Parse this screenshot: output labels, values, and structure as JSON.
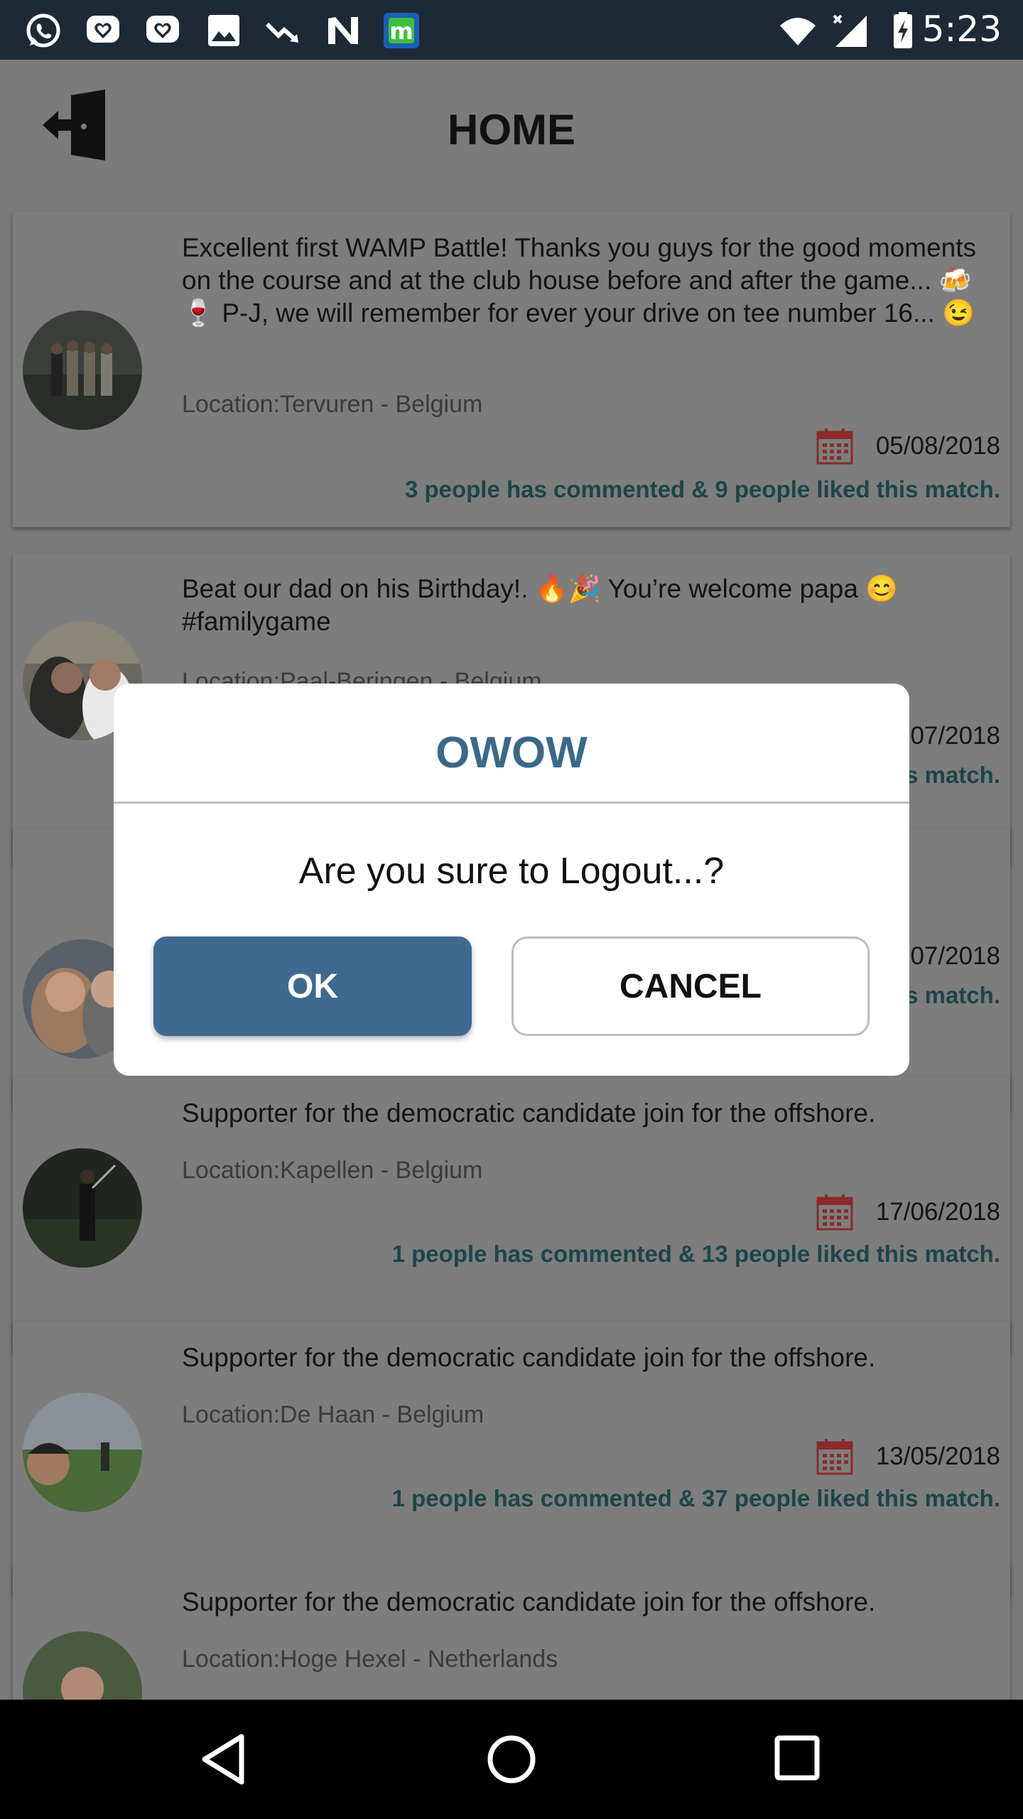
{
  "status_bar": {
    "time": "5:23",
    "left_icons": [
      "whatsapp-icon",
      "heart-chat-icon",
      "heart-chat-icon",
      "image-icon",
      "trend-down-icon",
      "n-icon",
      "m-app-icon"
    ],
    "right_icons": [
      "wifi-icon",
      "cell-signal-icon",
      "battery-charging-icon"
    ]
  },
  "header": {
    "title": "HOME",
    "logout_icon": "logout-door-icon"
  },
  "posts": [
    {
      "text": "Excellent first WAMP Battle! Thanks you guys for the good moments on the course and at the club house before and after the game... 🍻🍷 P-J, we will remember for ever your drive on tee number 16... 😉",
      "location": "Location:Tervuren - Belgium",
      "date": "05/08/2018",
      "stats": "3 people has commented & 9 people liked this match."
    },
    {
      "text": "Beat our dad on his Birthday!. 🔥🎉 You’re welcome papa 😊 #familygame",
      "location": "Location:Paal-Beringen - Belgium",
      "date": "07/2018",
      "stats": "s match."
    },
    {
      "text": "",
      "location": "",
      "date": "07/2018",
      "stats": "s match."
    },
    {
      "text": "Supporter for the democratic candidate join for the offshore.",
      "location": "Location:Kapellen - Belgium",
      "date": "17/06/2018",
      "stats": "1 people has commented & 13 people liked this match."
    },
    {
      "text": "Supporter for the democratic candidate join for the offshore.",
      "location": "Location:De Haan - Belgium",
      "date": "13/05/2018",
      "stats": "1 people has commented & 37 people liked this match."
    },
    {
      "text": "Supporter for the democratic candidate join for the offshore.",
      "location": "Location:Hoge Hexel - Netherlands",
      "date": "",
      "stats": ""
    }
  ],
  "dialog": {
    "title": "OWOW",
    "message": "Are you sure to Logout...?",
    "ok_label": "OK",
    "cancel_label": "CANCEL"
  },
  "nav_bar": {
    "icons": [
      "back-icon",
      "home-icon",
      "recents-icon"
    ]
  },
  "colors": {
    "accent": "#3f6a8f",
    "title_blue": "#3a6889",
    "status_bar": "#1d2a36",
    "calendar_red": "#b23a3a",
    "stats_teal": "#1e4548"
  }
}
